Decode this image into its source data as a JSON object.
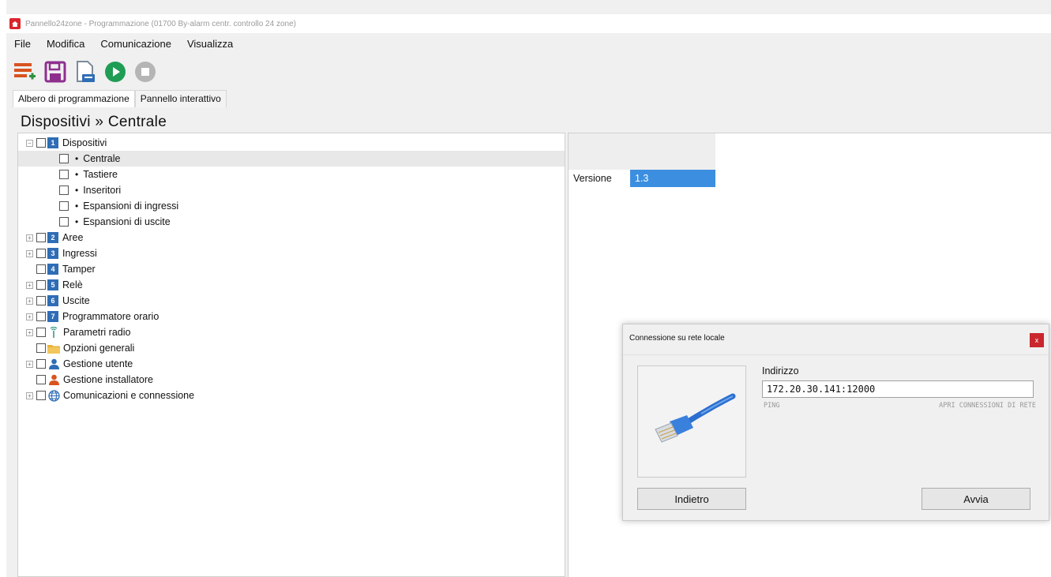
{
  "window": {
    "title": "Pannello24zone - Programmazione (01700 By-alarm centr. controllo 24 zone)"
  },
  "menu": [
    "File",
    "Modifica",
    "Comunicazione",
    "Visualizza"
  ],
  "toolbar": {
    "buttons": [
      "add-list-icon",
      "save-icon",
      "export-icon",
      "play-icon",
      "stop-icon"
    ],
    "colors": {
      "add": "#d9531e",
      "save": "#8e2f8f",
      "export": "#2f6db5",
      "play": "#1f9d55",
      "stop": "#b5b5b5"
    }
  },
  "tabs": [
    "Albero di programmazione",
    "Pannello interattivo"
  ],
  "breadcrumb": "Dispositivi » Centrale",
  "tree": {
    "dispositivi": {
      "num": "1",
      "label": "Dispositivi"
    },
    "children": [
      "Centrale",
      "Tastiere",
      "Inseritori",
      "Espansioni di ingressi",
      "Espansioni di uscite"
    ],
    "aree": {
      "num": "2",
      "label": "Aree"
    },
    "ingressi": {
      "num": "3",
      "label": "Ingressi"
    },
    "tamper": {
      "num": "4",
      "label": "Tamper"
    },
    "rele": {
      "num": "5",
      "label": "Relè"
    },
    "uscite": {
      "num": "6",
      "label": "Uscite"
    },
    "programmatore": {
      "num": "7",
      "label": "Programmatore orario"
    },
    "radio": {
      "label": "Parametri radio"
    },
    "opzioni": {
      "label": "Opzioni generali"
    },
    "utente": {
      "label": "Gestione utente"
    },
    "installatore": {
      "label": "Gestione installatore"
    },
    "comunicazioni": {
      "label": "Comunicazioni e connessione"
    }
  },
  "properties": {
    "label": "Versione",
    "value": "1.3"
  },
  "dialog": {
    "title": "Connessione su rete locale",
    "close": "x",
    "address_label": "Indirizzo",
    "address_value": "172.20.30.141:12000",
    "ping": "PING",
    "open_connections": "APRI CONNESSIONI DI RETE",
    "back": "Indietro",
    "start": "Avvia"
  }
}
